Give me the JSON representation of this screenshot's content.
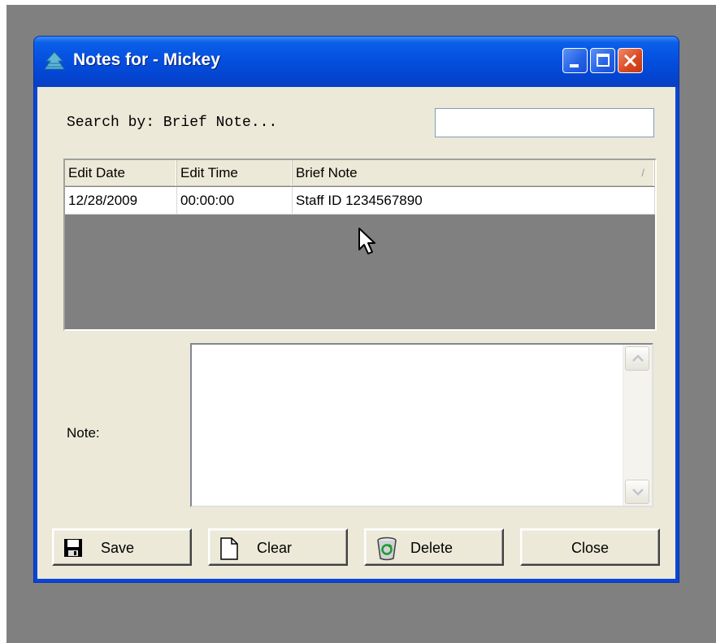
{
  "window": {
    "title": "Notes for - Mickey",
    "controls": {
      "minimize": "minimize",
      "maximize": "maximize",
      "close": "close"
    }
  },
  "search": {
    "label": "Search by: Brief Note...",
    "value": ""
  },
  "grid": {
    "columns": [
      "Edit Date",
      "Edit Time",
      "Brief Note"
    ],
    "sort_indicator": "/",
    "rows": [
      {
        "edit_date": "12/28/2009",
        "edit_time": "00:00:00",
        "brief_note": "Staff ID 1234567890"
      }
    ]
  },
  "note": {
    "label": "Note:",
    "value": ""
  },
  "buttons": {
    "save": "Save",
    "clear": "Clear",
    "delete": "Delete",
    "close": "Close"
  },
  "colors": {
    "titlebar": "#0550e0",
    "client_background": "#ece9d8",
    "grid_empty_background": "#808080",
    "desktop_background": "#808080",
    "close_button": "#d8471f"
  },
  "icons": {
    "app": "app-tree-icon",
    "save": "floppy-disk-icon",
    "clear": "blank-page-icon",
    "delete": "recycle-bin-icon",
    "cursor": "mouse-pointer-icon"
  }
}
